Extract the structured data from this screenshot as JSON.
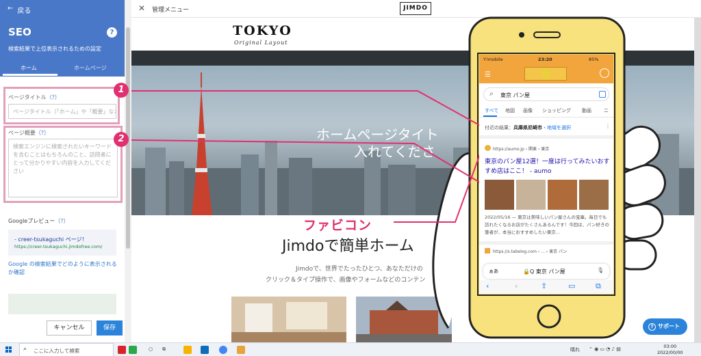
{
  "panel": {
    "back_label": "戻る",
    "title": "SEO",
    "help_glyph": "?",
    "description": "検索結果で上位表示されるための設定",
    "tabs": [
      {
        "label": "ホーム"
      },
      {
        "label": "ホームページ"
      }
    ],
    "page_title_label": "ページタイトル",
    "page_title_help": "（?）",
    "page_title_placeholder": "ページタイトル（「ホーム」や「概要」など）",
    "page_summary_label": "ページ概要",
    "page_summary_help": "（?）",
    "page_summary_placeholder": "検索エンジンに検索されたいキーワードを含むことはもちろんのこと、訪問者にとって分かりやすい内容を入力してください",
    "google_preview_label": "Googleプレビュー",
    "google_preview_help": "（?）",
    "preview_title": "- creer-tsukaguchi ページ！",
    "preview_url": "https://creer-tsukaguchi.jimdofree.com/",
    "preview_link": "Google の検索結果でどのように表示されるか確認",
    "cancel_label": "キャンセル",
    "save_label": "保存"
  },
  "topbar": {
    "menu_label": "管理メニュー",
    "logo": "JIMDO"
  },
  "site": {
    "logo": "TOKYO",
    "logo_sub": "Original Layout",
    "hero_line1": "ホームページタイト",
    "hero_line2": "入れてくださ",
    "section_title": "Jimdoで簡単ホーム",
    "section_text1": "Jimdoで、世界でたったひとつ、あなただけの",
    "section_text2": "クリック＆タイプ操作で、画像やフォームなどのコンテン"
  },
  "annotations": {
    "badge1": "1",
    "badge2": "2",
    "favicon_label": "ファビコン",
    "accent_color": "#e0306f"
  },
  "phone": {
    "carrier": "Y!mobile",
    "time": "23:20",
    "battery": "85%",
    "search_query": "東京 パン屋",
    "tabs": [
      {
        "label": "すべて"
      },
      {
        "label": "地図"
      },
      {
        "label": "画像"
      },
      {
        "label": "ショッピング"
      },
      {
        "label": "動画"
      },
      {
        "label": "ニ"
      }
    ],
    "location_prefix": "付近の結果：",
    "location_place": "兵庫県尼崎市",
    "location_link": "・地域を選択",
    "result1_url": "https://aumo.jp › 関東 › 東京",
    "result1_title": "東京のパン屋12選！一度は行ってみたいおすすめ店はここ！ - aumo",
    "result1_snippet": "2022/05/16 — 東京は美味しいパン屋さんの宝庫。毎日でも訪れたくなるお店がたくさんあるんです！今回は、パン好きの筆者が、本当におすすめしたい東京...",
    "result2_url": "https://s.tabelog.com › ... › 東京 パン",
    "safari_aa": "ぁあ",
    "safari_address": "🔒Q 東京 パン屋"
  },
  "support_label": "サポート",
  "taskbar": {
    "search_placeholder": "ここに入力して検索",
    "weather": "晴れ",
    "time": "03:00",
    "date": "2022/00/00"
  }
}
